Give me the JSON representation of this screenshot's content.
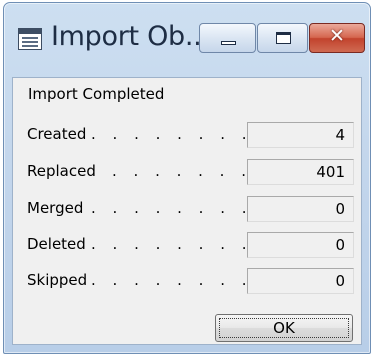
{
  "window": {
    "title": "Import Ob...",
    "icon": "form-window-icon",
    "controls": {
      "minimize": "minimize-icon",
      "maximize": "maximize-icon",
      "close": "close-icon",
      "close_glyph": "✕"
    }
  },
  "dialog": {
    "heading": "Import Completed",
    "rows": [
      {
        "label": "Created",
        "dots": ". . . . . . . . .",
        "value": "4"
      },
      {
        "label": "Replaced",
        "dots": ". . . . . . .",
        "value": "401"
      },
      {
        "label": "Merged",
        "dots": ". . . . . . . . .",
        "value": "0"
      },
      {
        "label": "Deleted",
        "dots": ". . . . . . . . .",
        "value": "0"
      },
      {
        "label": "Skipped",
        "dots": ". . . . . . . . .",
        "value": "0"
      }
    ],
    "ok_label": "OK"
  }
}
